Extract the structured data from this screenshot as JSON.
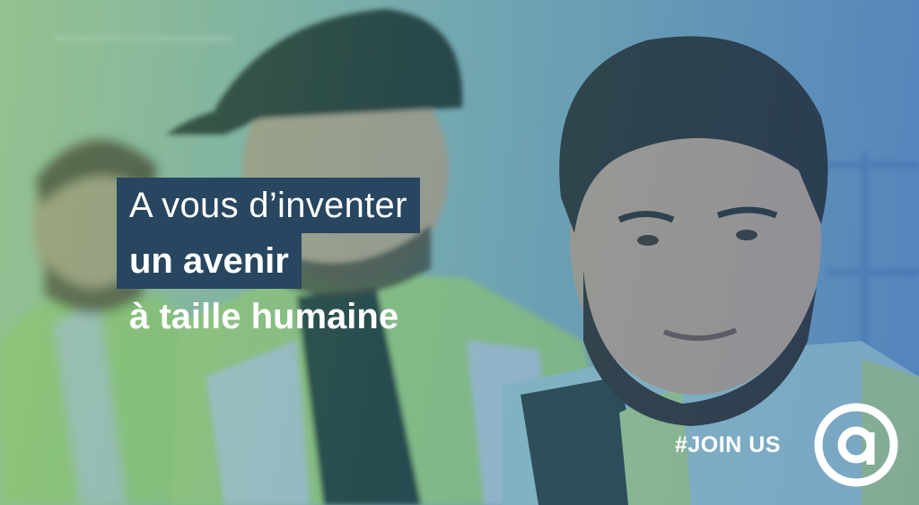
{
  "headline": {
    "line1": "A vous d’inventer",
    "line2": "un avenir",
    "line3": "à taille humaine"
  },
  "hashtag": "#JOIN US",
  "colors": {
    "banner": "#28465f",
    "text": "#ffffff",
    "overlay_green": "#78b96e",
    "overlay_blue": "#285faa",
    "vest_yellow": "#c8e07a"
  },
  "icons": [
    "brand-logo-icon"
  ]
}
